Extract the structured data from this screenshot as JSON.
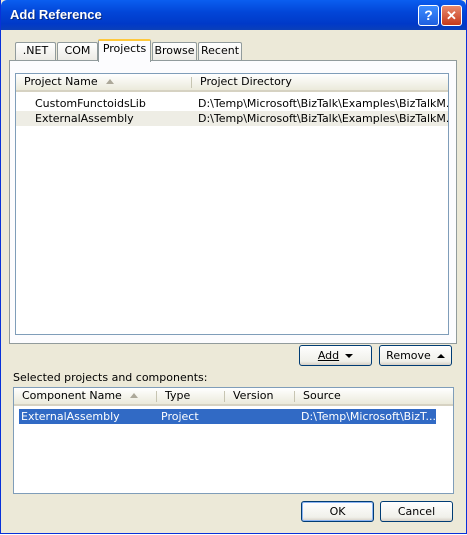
{
  "window": {
    "title": "Add Reference",
    "help_glyph": "?",
    "close_glyph": "✕"
  },
  "tabs": [
    {
      "label": ".NET"
    },
    {
      "label": "COM"
    },
    {
      "label": "Projects"
    },
    {
      "label": "Browse"
    },
    {
      "label": "Recent"
    }
  ],
  "projects_list": {
    "columns": [
      "Project Name",
      "Project Directory"
    ],
    "rows": [
      {
        "name": "CustomFunctoidsLib",
        "dir": "D:\\Temp\\Microsoft\\BizTalk\\Examples\\BizTalkM..."
      },
      {
        "name": "ExternalAssembly",
        "dir": "D:\\Temp\\Microsoft\\BizTalk\\Examples\\BizTalkM..."
      }
    ]
  },
  "buttons": {
    "add": "Add",
    "remove": "Remove",
    "ok": "OK",
    "cancel": "Cancel"
  },
  "selected_label": "Selected projects and components:",
  "selected_list": {
    "columns": [
      "Component Name",
      "Type",
      "Version",
      "Source"
    ],
    "rows": [
      {
        "name": "ExternalAssembly",
        "type": "Project",
        "version": "",
        "source": "D:\\Temp\\Microsoft\\BizT..."
      }
    ]
  },
  "colors": {
    "titlebar": "#0246d8",
    "selection": "#316ac5",
    "row_hover": "#eeede5",
    "dialog_bg": "#ece9d8"
  }
}
